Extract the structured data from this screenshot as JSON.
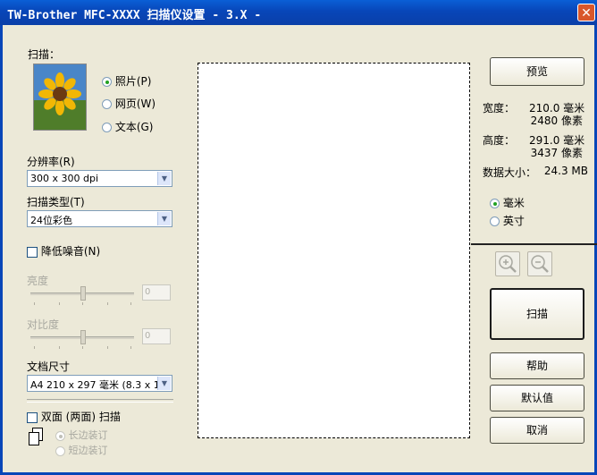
{
  "window": {
    "title": "TW-Brother MFC-XXXX 扫描仪设置 - 3.X -",
    "close_glyph": "✕"
  },
  "scan": {
    "heading": "扫描：",
    "modes": [
      {
        "label": "照片(P)",
        "selected": true
      },
      {
        "label": "网页(W)",
        "selected": false
      },
      {
        "label": "文本(G)",
        "selected": false
      }
    ]
  },
  "resolution": {
    "label": "分辨率(R)",
    "value": "300 x 300 dpi"
  },
  "scan_type": {
    "label": "扫描类型(T)",
    "value": "24位彩色"
  },
  "noise": {
    "label": "降低噪音(N)",
    "checked": false
  },
  "brightness": {
    "label": "亮度",
    "value": "0",
    "level": 0.5
  },
  "contrast": {
    "label": "对比度",
    "value": "0",
    "level": 0.5
  },
  "doc_size": {
    "label": "文档尺寸",
    "value": "A4 210 x 297 毫米 (8.3 x 1"
  },
  "duplex": {
    "label": "双面 (两面) 扫描",
    "checked": false,
    "options": [
      {
        "label": "长边装订",
        "selected": true
      },
      {
        "label": "短边装订",
        "selected": false
      }
    ]
  },
  "right": {
    "preview_button": "预览",
    "width_label": "宽度：",
    "width_mm": "210.0 毫米",
    "width_px": "2480 像素",
    "height_label": "高度：",
    "height_mm": "291.0 毫米",
    "height_px": "3437 像素",
    "datasize_label": "数据大小：",
    "datasize_value": "24.3 MB",
    "units": [
      {
        "label": "毫米",
        "selected": true
      },
      {
        "label": "英寸",
        "selected": false
      }
    ],
    "scan_button": "扫描",
    "help_button": "帮助",
    "default_button": "默认值",
    "cancel_button": "取消"
  },
  "colors": {
    "titlebar": "#0846b8",
    "close": "#d9572b",
    "window_bg": "#ece9d8",
    "radio_dot": "#21a121"
  }
}
